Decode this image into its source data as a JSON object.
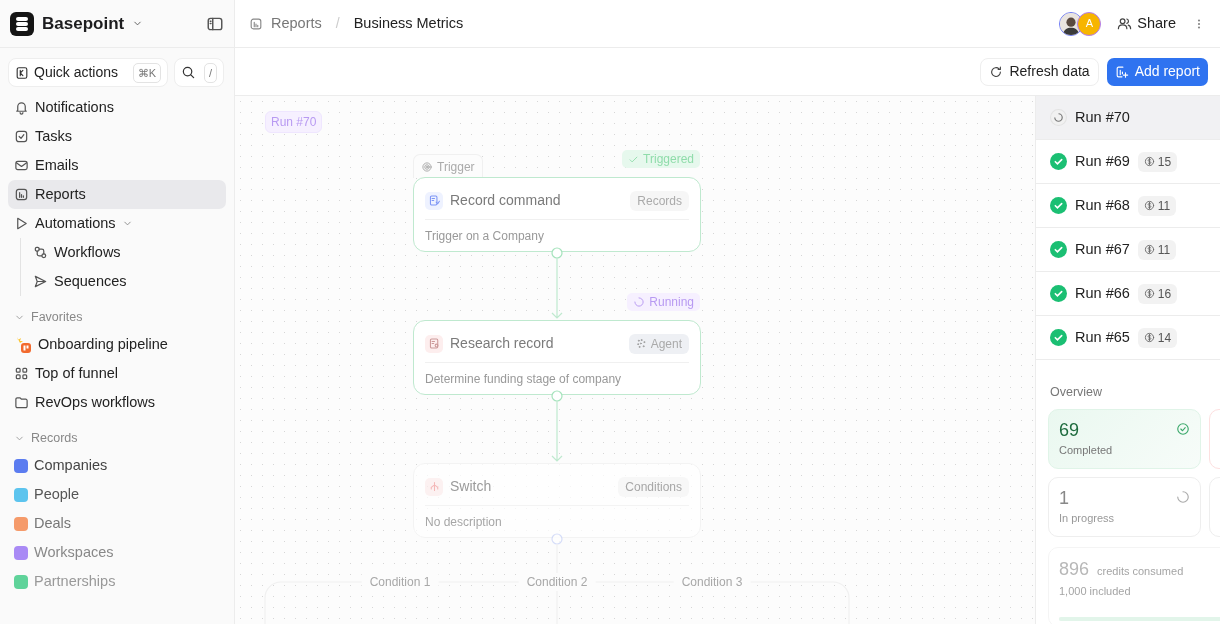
{
  "workspace": {
    "name": "Basepoint"
  },
  "quick_actions": {
    "label": "Quick actions",
    "shortcut": "⌘K",
    "search_shortcut": "/"
  },
  "nav": [
    {
      "label": "Notifications",
      "selected": false
    },
    {
      "label": "Tasks",
      "selected": false
    },
    {
      "label": "Emails",
      "selected": false
    },
    {
      "label": "Reports",
      "selected": true
    },
    {
      "label": "Automations",
      "selected": false,
      "expanded": true,
      "children": [
        {
          "label": "Workflows",
          "selected": false
        },
        {
          "label": "Sequences",
          "selected": false
        }
      ]
    }
  ],
  "favorites": {
    "title": "Favorites",
    "expanded": true,
    "items": [
      {
        "label": "Onboarding pipeline"
      },
      {
        "label": "Top of funnel"
      },
      {
        "label": "RevOps workflows"
      }
    ]
  },
  "records": {
    "title": "Records",
    "expanded": true,
    "items": [
      {
        "label": "Companies",
        "color": "#5b7cf0"
      },
      {
        "label": "People",
        "color": "#5cc4ee"
      },
      {
        "label": "Deals",
        "color": "#f59a6a"
      },
      {
        "label": "Workspaces",
        "color": "#a98af5"
      },
      {
        "label": "Partnerships",
        "color": "#5fd39a"
      }
    ]
  },
  "breadcrumb": {
    "items": [
      {
        "label": "Reports"
      },
      {
        "label": "Business Metrics"
      }
    ],
    "separator": "/"
  },
  "avatars": [
    {
      "kind": "photo"
    },
    {
      "kind": "initial",
      "initial": "A",
      "color": "#f7b500"
    }
  ],
  "share_label": "Share",
  "toolbar": {
    "refresh": "Refresh data",
    "add": "Add report"
  },
  "canvas": {
    "run_label": "Run #70",
    "nodes": [
      {
        "tab": "Trigger",
        "status": {
          "kind": "triggered",
          "label": "Triggered"
        },
        "title": "Record command",
        "tag": "Records",
        "description": "Trigger on a Company"
      },
      {
        "status": {
          "kind": "running",
          "label": "Running"
        },
        "title": "Research record",
        "tag": "Agent",
        "description": "Determine funding stage of company"
      },
      {
        "title": "Switch",
        "tag": "Conditions",
        "description": "No description"
      }
    ],
    "conditions": [
      "Condition 1",
      "Condition 2",
      "Condition 3"
    ]
  },
  "runs": [
    {
      "label": "Run #70",
      "kind": "running",
      "selected": true
    },
    {
      "label": "Run #69",
      "kind": "done",
      "credits": "15",
      "selected": false
    },
    {
      "label": "Run #68",
      "kind": "done",
      "credits": "11",
      "selected": false
    },
    {
      "label": "Run #67",
      "kind": "done",
      "credits": "11",
      "selected": false
    },
    {
      "label": "Run #66",
      "kind": "done",
      "credits": "16",
      "selected": false
    },
    {
      "label": "Run #65",
      "kind": "done",
      "credits": "14",
      "selected": false
    }
  ],
  "overview": {
    "title": "Overview",
    "stats": [
      {
        "kind": "completed",
        "value": "69",
        "label": "Completed"
      },
      {
        "kind": "progress",
        "value": "1",
        "label": "In progress"
      }
    ],
    "credits": {
      "value": "896",
      "label": "credits consumed",
      "included": "1,000 included",
      "level": 0.896
    }
  }
}
